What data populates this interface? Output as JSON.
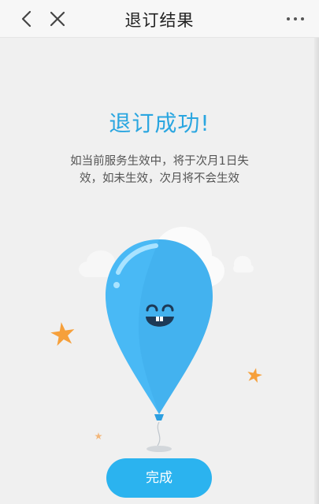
{
  "nav": {
    "title": "退订结果",
    "back_icon": "chevron-left-icon",
    "close_icon": "close-icon",
    "more_icon": "more-horizontal-icon"
  },
  "result": {
    "title": "退订成功!",
    "description": "如当前服务生效中，将于次月1日失效，如未生效，次月将不会生效"
  },
  "actions": {
    "done_label": "完成"
  },
  "colors": {
    "accent": "#2aa6e0",
    "button": "#2bb3ef",
    "balloon": "#49b9f5",
    "star": "#f6a03b"
  }
}
